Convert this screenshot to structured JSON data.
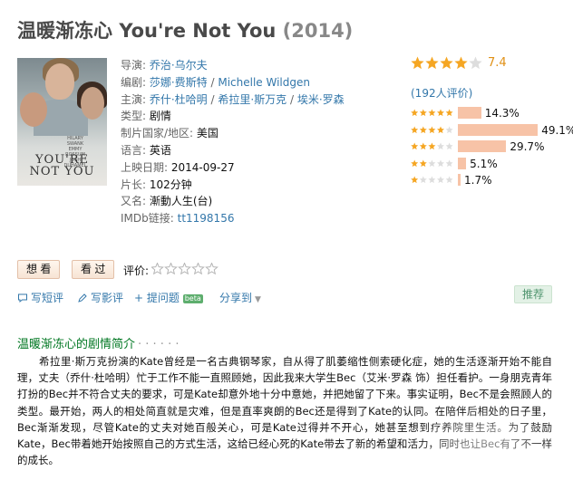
{
  "header": {
    "title_cn": "温暖渐冻心",
    "title_en": "You're Not You",
    "year": "(2014)"
  },
  "poster": {
    "credit_line1": "HILARY",
    "credit_line2": "SWANK",
    "credit_line3": "EMMY",
    "credit_line4": "ROSSUM",
    "credit_line5": "JOSH",
    "credit_line6": "DUHAMEL",
    "title_line1": "YOU'RE",
    "title_line2": "NOT YOU"
  },
  "info": {
    "director_label": "导演: ",
    "director": "乔治·乌尔夫",
    "writer_label": "编剧: ",
    "writer_1": "莎娜·费斯特",
    "writer_2": "Michelle Wildgen",
    "cast_label": "主演: ",
    "cast_1": "乔什·杜哈明",
    "cast_2": "希拉里·斯万克",
    "cast_3": "埃米·罗森",
    "separator": " / ",
    "genre_label": "类型: ",
    "genre": "剧情",
    "country_label": "制片国家/地区: ",
    "country": "美国",
    "language_label": "语言: ",
    "language": "英语",
    "release_label": "上映日期: ",
    "release": "2014-09-27",
    "runtime_label": "片长: ",
    "runtime": "102分钟",
    "aka_label": "又名: ",
    "aka": "漸動人生(台)",
    "imdb_label": "IMDb链接: ",
    "imdb": "tt1198156"
  },
  "rating": {
    "score": "7.4",
    "score_value": 7.4,
    "stars_filled": 4,
    "votes": "(192人评价)",
    "distribution": [
      {
        "stars": 5,
        "percent": 14.3,
        "label": "14.3%"
      },
      {
        "stars": 4,
        "percent": 49.1,
        "label": "49.1%"
      },
      {
        "stars": 3,
        "percent": 29.7,
        "label": "29.7%"
      },
      {
        "stars": 2,
        "percent": 5.1,
        "label": "5.1%"
      },
      {
        "stars": 1,
        "percent": 1.7,
        "label": "1.7%"
      }
    ]
  },
  "marks": {
    "want_label": "想 看",
    "seen_label": "看 过",
    "rate_label": "评价:"
  },
  "actions": {
    "write_short": "写短评",
    "write_review": "写影评",
    "add_label": "+ 提问题",
    "beta": "beta",
    "share_label": "分享到",
    "recommend": "推荐"
  },
  "summary": {
    "heading": "温暖渐冻心的剧情简介",
    "dots": "· · · · · ·",
    "text": "希拉里·斯万克扮演的Kate曾经是一名古典钢琴家，自从得了肌萎缩性侧索硬化症，她的生活逐渐开始不能自理，丈夫（乔什·杜哈明）忙于工作不能一直照顾她，因此我来大学生Bec（艾米·罗森 饰）担任看护。一身朋克青年打扮的Bec并不符合丈夫的要求，可是Kate却意外地十分中意她，并把她留了下来。事实证明，Bec不是会照顾人的类型。最开始，两人的相处简直就是灾难，但是直率爽朗的Bec还是得到了Kate的认同。在陪伴后相处的日子里，Bec渐渐发现，尽管Kate的丈夫对她百般关心，可是Kate过得并不开心，她甚至想到疗养院里生活。为了鼓励Kate，Bec带着她开始按照自己的方式生活，这给已经心死的Kate带去了新的希望和活力，同时也让Bec有了不一样的成长。"
  },
  "colors": {
    "link": "#3377aa",
    "star": "#f5a623",
    "score": "#e09015",
    "bar": "#f7c3a7",
    "section_green": "#007722"
  }
}
